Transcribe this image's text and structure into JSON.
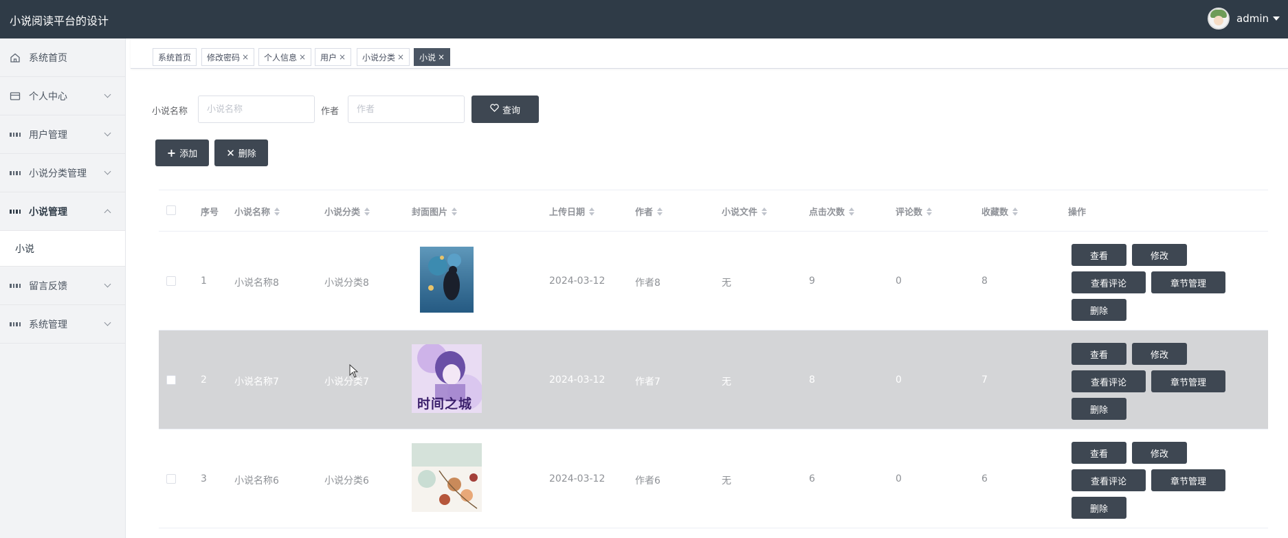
{
  "header": {
    "title": "小说阅读平台的设计",
    "username": "admin"
  },
  "sidebar": {
    "items": [
      {
        "label": "系统首页",
        "icon": "home-icon"
      },
      {
        "label": "个人中心",
        "icon": "wallet-icon"
      },
      {
        "label": "用户管理",
        "icon": "grid-icon"
      },
      {
        "label": "小说分类管理",
        "icon": "grid-icon"
      },
      {
        "label": "小说管理",
        "icon": "grid-icon"
      },
      {
        "label": "留言反馈",
        "icon": "grid-icon"
      },
      {
        "label": "系统管理",
        "icon": "grid-icon"
      }
    ],
    "subitem": "小说"
  },
  "tabs": [
    {
      "label": "系统首页",
      "closable": false
    },
    {
      "label": "修改密码",
      "closable": true
    },
    {
      "label": "个人信息",
      "closable": true
    },
    {
      "label": "用户",
      "closable": true
    },
    {
      "label": "小说分类",
      "closable": true
    },
    {
      "label": "小说",
      "closable": true,
      "active": true
    }
  ],
  "tab_close": "×",
  "search": {
    "name_label": "小说名称",
    "name_placeholder": "小说名称",
    "author_label": "作者",
    "author_placeholder": "作者",
    "query_button": "查询"
  },
  "toolbar": {
    "add_label": "添加",
    "delete_label": "删除"
  },
  "table": {
    "headers": {
      "index": "序号",
      "name": "小说名称",
      "category": "小说分类",
      "cover": "封面图片",
      "date": "上传日期",
      "author": "作者",
      "file": "小说文件",
      "clicks": "点击次数",
      "comments": "评论数",
      "favorites": "收藏数",
      "actions": "操作"
    },
    "rows": [
      {
        "index": "1",
        "name": "小说名称8",
        "category": "小说分类8",
        "date": "2024-03-12",
        "author": "作者8",
        "file": "无",
        "clicks": "9",
        "comments": "0",
        "favorites": "8"
      },
      {
        "index": "2",
        "name": "小说名称7",
        "category": "小说分类7",
        "date": "2024-03-12",
        "author": "作者7",
        "file": "无",
        "clicks": "8",
        "comments": "0",
        "favorites": "7"
      },
      {
        "index": "3",
        "name": "小说名称6",
        "category": "小说分类6",
        "date": "2024-03-12",
        "author": "作者6",
        "file": "无",
        "clicks": "6",
        "comments": "0",
        "favorites": "6"
      }
    ],
    "cover_text_row2": "时间之城",
    "actions": {
      "view": "查看",
      "edit": "修改",
      "view_comments": "查看评论",
      "chapters": "章节管理",
      "delete": "删除"
    }
  },
  "colors": {
    "header_bg": "#2f3b47",
    "button_bg": "#3e4752",
    "sidebar_bg": "#f2f3f5",
    "hover_row": "#d4d5d7"
  }
}
